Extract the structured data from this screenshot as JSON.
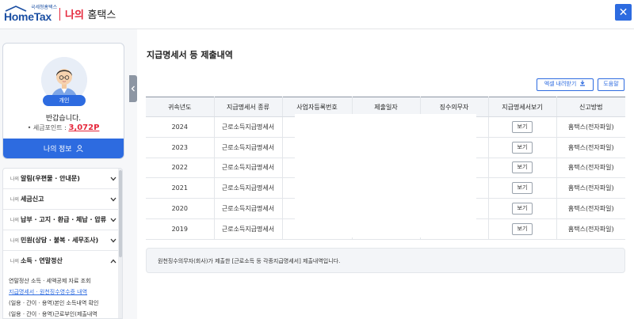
{
  "header": {
    "logo_small": "국세청홈택스",
    "logo_main": "HomeTax",
    "title_accent": "나의",
    "title_rest": "홈택스",
    "close_label": "✕"
  },
  "profile": {
    "badge": "개인",
    "greeting": "반갑습니다.",
    "points_label": "• 세금포인트 :",
    "points_value": "3,072P",
    "my_info_label": "나의 정보"
  },
  "menu": {
    "items": [
      {
        "prefix": "나의",
        "label": "알림(우편물 · 안내문)",
        "chevron": "down"
      },
      {
        "prefix": "나의",
        "label": "세금신고",
        "chevron": "down"
      },
      {
        "prefix": "나의",
        "label": "납부 · 고지 · 환급 · 체납 · 압류",
        "chevron": "down"
      },
      {
        "prefix": "나의",
        "label": "민원(상담 · 불복 · 세무조사)",
        "chevron": "down"
      },
      {
        "prefix": "나의",
        "label": "소득 · 연말정산",
        "chevron": "up"
      }
    ],
    "sub_items": [
      "연말정산 소득 · 세액공제 자료 조회",
      "지급명세서 · 원천징수영수증 내역",
      "(일용 · 간이 · 용역)본인 소득내역 확인",
      "(일용 · 간이 · 용역)근로부인(제출내역"
    ],
    "active_sub": 1
  },
  "main": {
    "title": "지급명세서 등 제출내역",
    "excel_button": "엑셀 내려받기",
    "help_button": "도움말",
    "columns": [
      "귀속년도",
      "지급명세서 종류",
      "사업자등록번호",
      "제출일자",
      "징수의무자",
      "지급명세서보기",
      "신고방법"
    ],
    "rows": [
      {
        "year": "2024",
        "type": "근로소득지급명세서",
        "view": "보기",
        "method": "홈택스(전자파일)"
      },
      {
        "year": "2023",
        "type": "근로소득지급명세서",
        "view": "보기",
        "method": "홈택스(전자파일)"
      },
      {
        "year": "2022",
        "type": "근로소득지급명세서",
        "view": "보기",
        "method": "홈택스(전자파일)"
      },
      {
        "year": "2021",
        "type": "근로소득지급명세서",
        "view": "보기",
        "method": "홈택스(전자파일)"
      },
      {
        "year": "2020",
        "type": "근로소득지급명세서",
        "view": "보기",
        "method": "홈택스(전자파일)"
      },
      {
        "year": "2019",
        "type": "근로소득지급명세서",
        "view": "보기",
        "method": "홈택스(전자파일)"
      }
    ],
    "notice": "원천징수의무자(회사)가 제출한 [근로소득 등 각종지급명세서] 제출내역입니다."
  },
  "colors": {
    "accent_blue": "#2d6be0",
    "accent_red": "#e5273b",
    "logo_blue": "#1b4fa3"
  },
  "icons": [
    "close-icon",
    "user-avatar-icon",
    "person-icon",
    "chevron-left-icon",
    "chevron-down-icon",
    "chevron-up-icon",
    "download-icon"
  ]
}
